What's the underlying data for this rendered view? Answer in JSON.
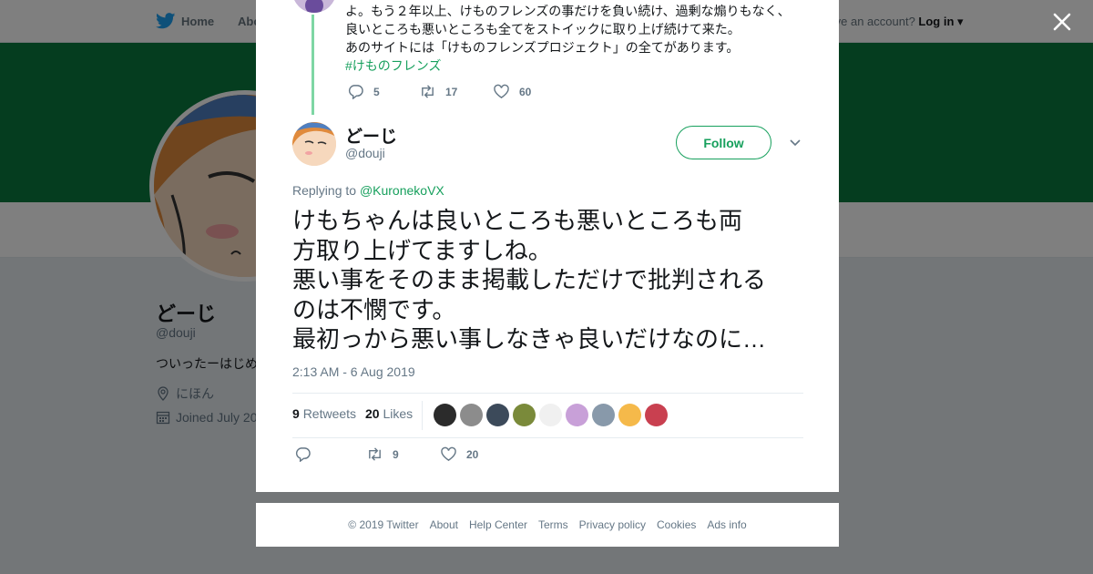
{
  "nav": {
    "home_label": "Home",
    "about_label": "About",
    "account_prompt": "Have an account?",
    "login_label": "Log in"
  },
  "profile": {
    "name": "どーじ",
    "handle": "@douji",
    "bio": "ついったーはじめ",
    "location": "にほん",
    "joined": "Joined July 20"
  },
  "previous_tweet": {
    "lines": [
      "よ。もう２年以上、けものフレンズの事だけを負い続け、過剰な煽りもなく、",
      "良いところも悪いところも全てをストイックに取り上げ続けて来た。",
      "あのサイトには「けものフレンズプロジェクト」の全てがあります。"
    ],
    "hashtag": "#けものフレンズ",
    "replies": "5",
    "retweets": "17",
    "likes": "60"
  },
  "tweet": {
    "author_name": "どーじ",
    "author_handle": "@douji",
    "follow_label": "Follow",
    "replying_prefix": "Replying to",
    "replying_to": "@KuronekoVX",
    "lines": [
      "けもちゃんは良いところも悪いところも両",
      "方取り上げてますしね。",
      "悪い事をそのまま掲載しただけで批判される",
      "のは不憫です。",
      "最初っから悪い事しなきゃ良いだけなのに…"
    ],
    "timestamp": "2:13 AM - 6 Aug 2019",
    "retweet_count": "9",
    "retweet_label": "Retweets",
    "like_count": "20",
    "like_label": "Likes",
    "action_retweets": "9",
    "action_likes": "20"
  },
  "likers": [
    "#2b2b2b",
    "#8c8c8c",
    "#3c4a5a",
    "#7a8a3a",
    "#f0f0f0",
    "#c8a0d8",
    "#8899aa",
    "#f5b94a",
    "#c94050"
  ],
  "footer": {
    "copyright": "© 2019 Twitter",
    "links": [
      "About",
      "Help Center",
      "Terms",
      "Privacy policy",
      "Cookies",
      "Ads info"
    ]
  },
  "colors": {
    "accent": "#17a05d",
    "banner": "#0a7a3f",
    "thread_line": "#7ed6a4",
    "muted": "#657786"
  }
}
